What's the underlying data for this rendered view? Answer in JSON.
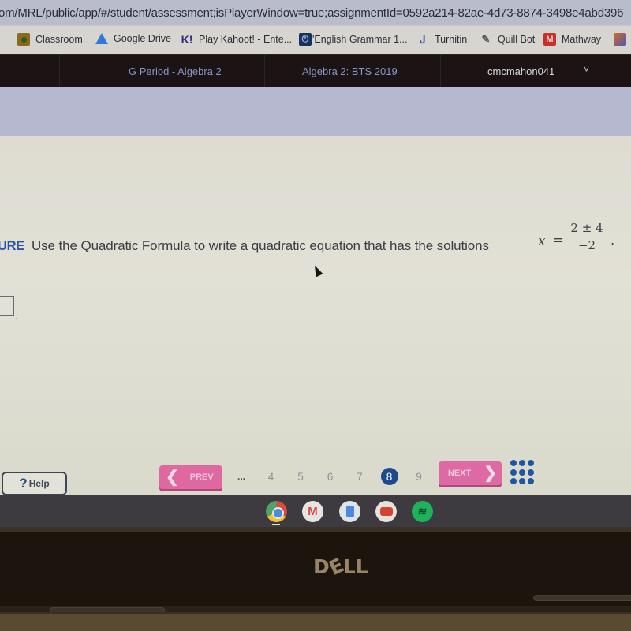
{
  "browser": {
    "url": "om/MRL/public/app/#/student/assessment;isPlayerWindow=true;assignmentId=0592a214-82ae-4d73-8874-3498e4abd396",
    "bookmarks": [
      {
        "label": "Classroom",
        "icon": "google-classroom-icon"
      },
      {
        "label": "Google Drive",
        "icon": "google-drive-icon"
      },
      {
        "label": "Play Kahoot! - Ente...",
        "icon": "kahoot-icon",
        "glyph": "K!"
      },
      {
        "label": "'English Grammar 1...",
        "icon": "english-grammar-icon",
        "glyph": "⏻"
      },
      {
        "label": "Turnitin",
        "icon": "turnitin-icon",
        "glyph": "Ꭻ"
      },
      {
        "label": "Quill Bot",
        "icon": "quill-icon",
        "glyph": "✎"
      },
      {
        "label": "Mathway",
        "icon": "mathway-icon",
        "glyph": "M"
      },
      {
        "label": "",
        "icon": "extension-icon"
      }
    ]
  },
  "header": {
    "class_name": "G Period - Algebra 2",
    "assignment_name": "Algebra 2: BTS 2019",
    "username": "cmcmahon041",
    "dropdown_glyph": "˅"
  },
  "question": {
    "tag": "URE",
    "text": "Use the Quadratic Formula to write a quadratic equation that has the solutions",
    "math": {
      "variable": "x",
      "equals": "=",
      "numerator": "2 ± 4",
      "denominator": "−2",
      "trailing": "."
    },
    "answer_value": "",
    "answer_trailing": "."
  },
  "navigation": {
    "help_label": "Help",
    "help_glyph": "?",
    "prev_label": "PREV",
    "next_label": "NEXT",
    "prev_glyph": "❮",
    "next_glyph": "❯",
    "pages": [
      "...",
      "4",
      "5",
      "6",
      "7",
      "8",
      "9"
    ],
    "current_page": "8"
  },
  "shelf": {
    "apps": [
      {
        "name": "Chrome",
        "active": true
      },
      {
        "name": "Gmail",
        "glyph": "M"
      },
      {
        "name": "Google Docs"
      },
      {
        "name": "YouTube"
      },
      {
        "name": "Spotify",
        "glyph": "≋"
      }
    ]
  },
  "device": {
    "brand_d": "D",
    "brand_e": "E",
    "brand_ll": "LL"
  }
}
